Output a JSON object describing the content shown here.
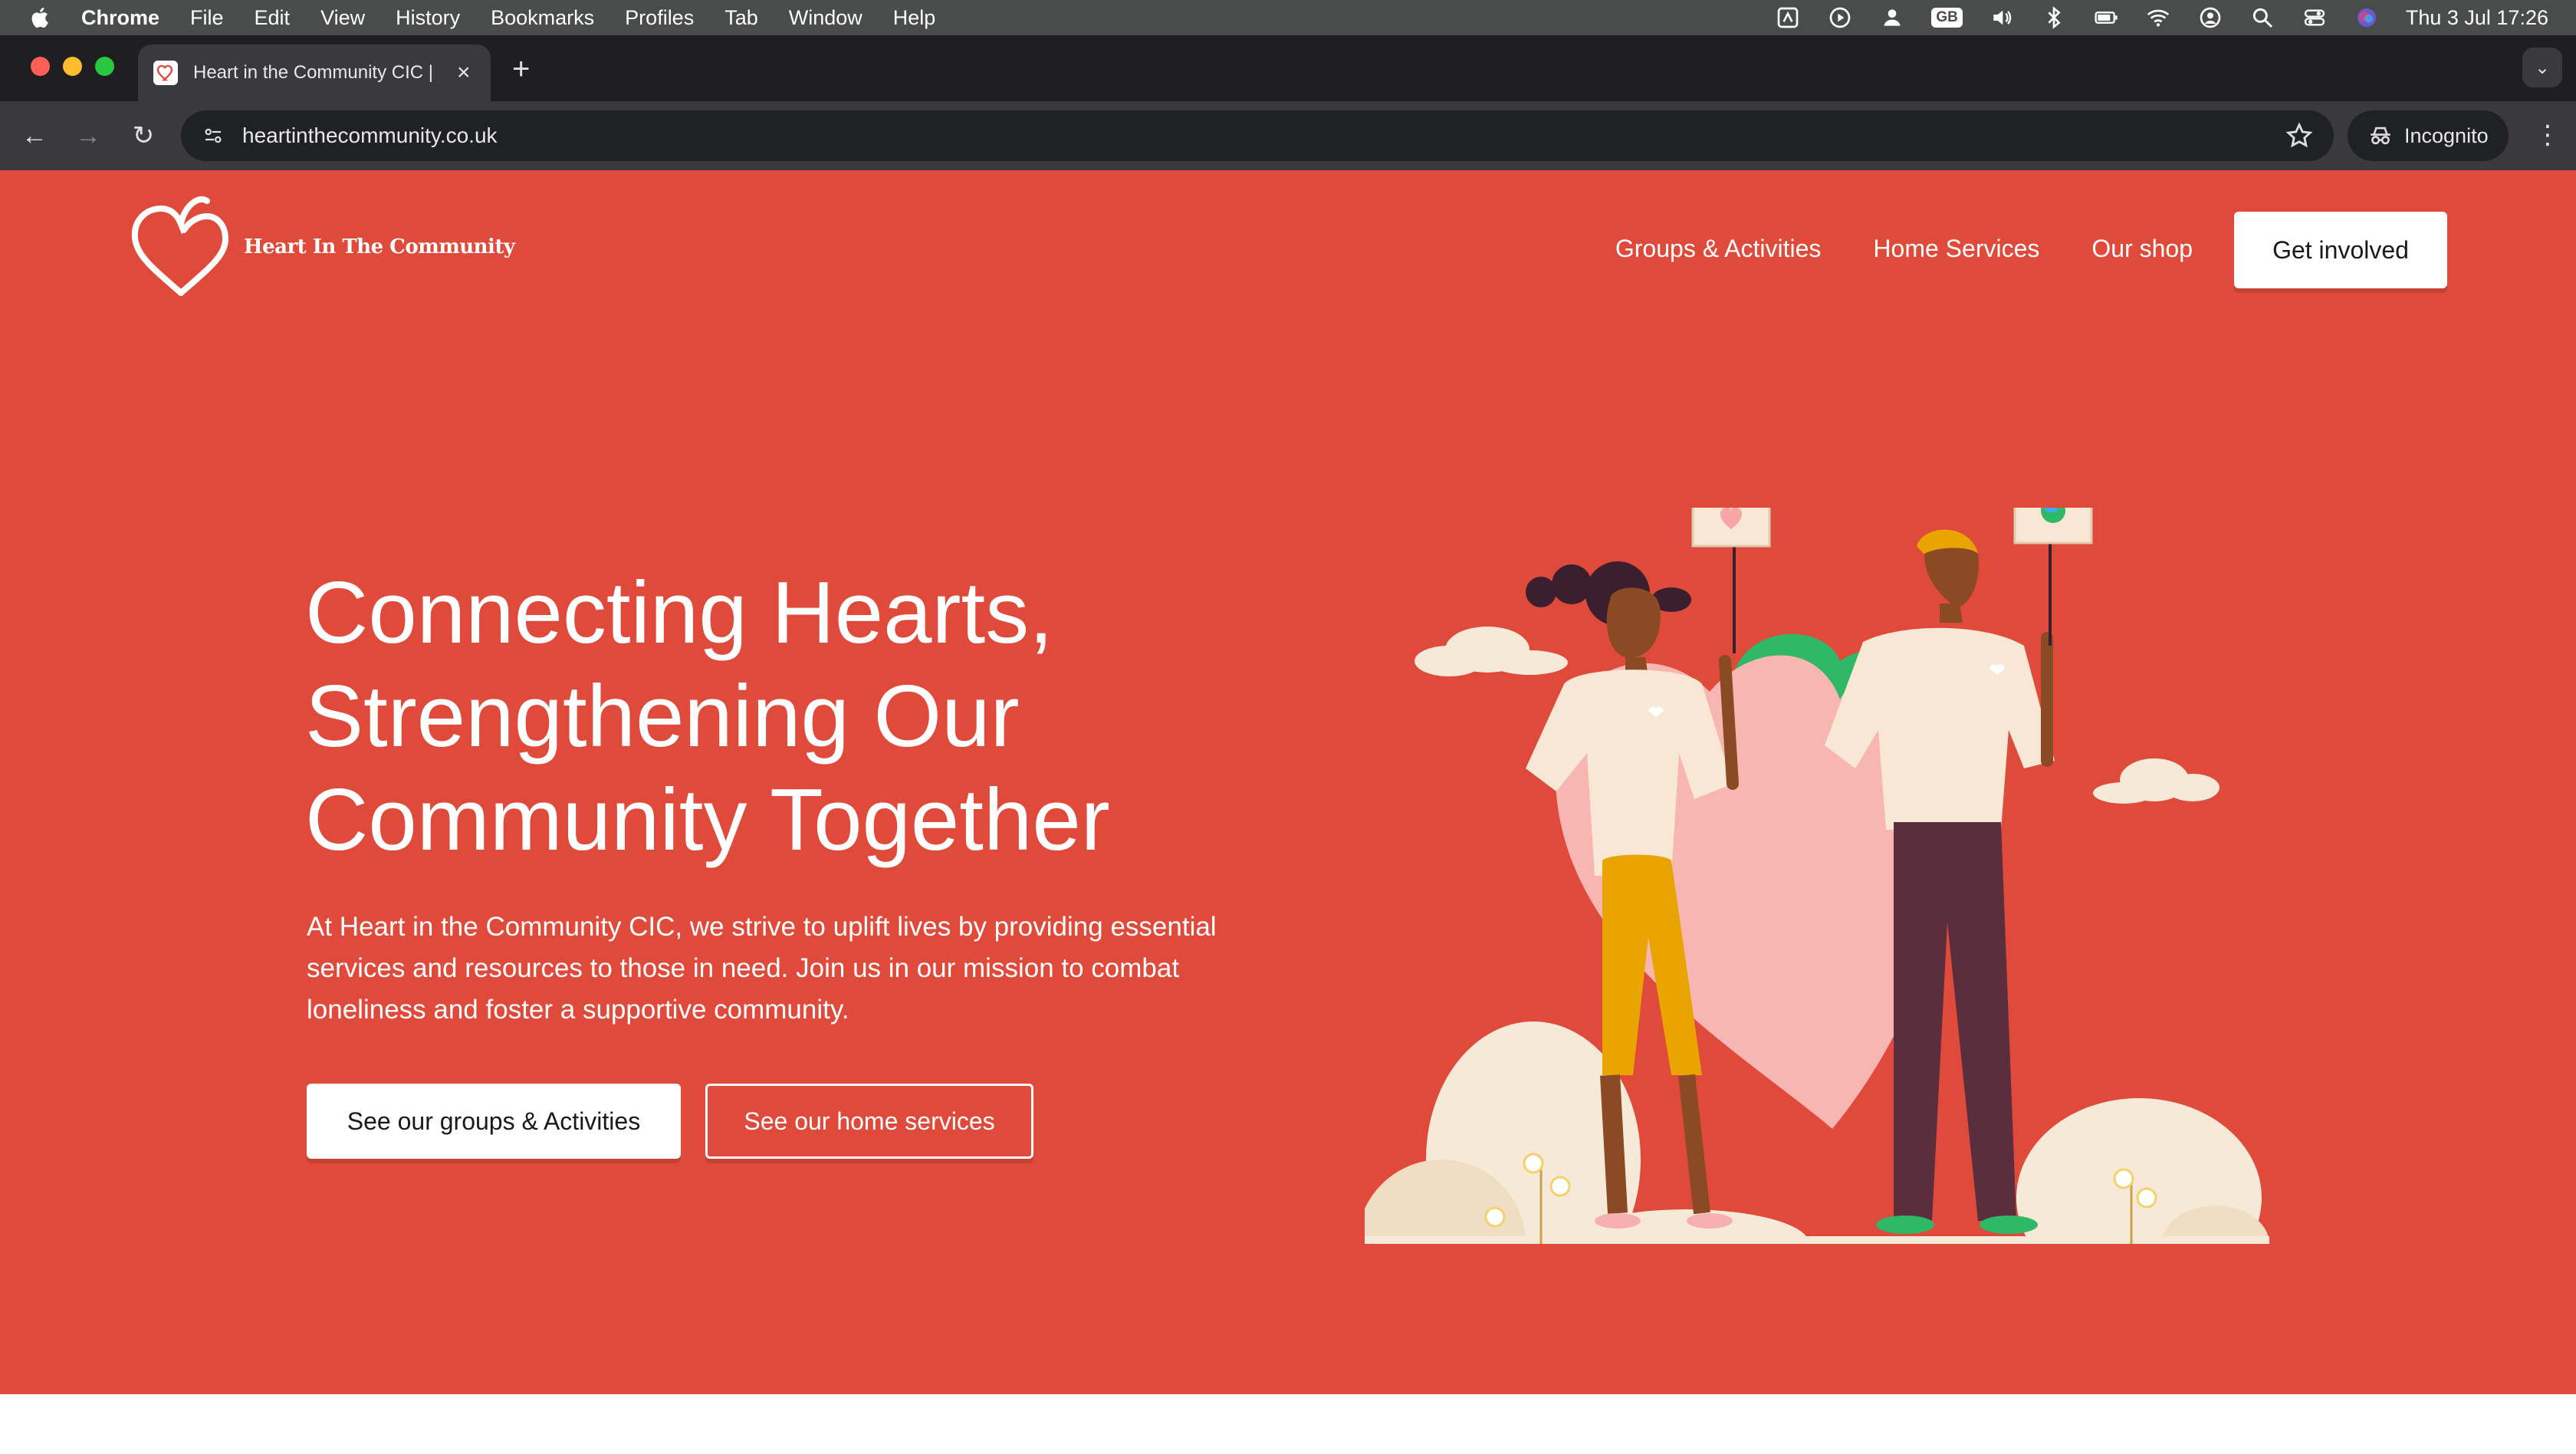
{
  "menubar": {
    "app_name": "Chrome",
    "items": [
      "File",
      "Edit",
      "View",
      "History",
      "Bookmarks",
      "Profiles",
      "Tab",
      "Window",
      "Help"
    ],
    "keyboard_layout": "GB",
    "clock": "Thu 3 Jul  17:26"
  },
  "browser": {
    "tab_title": "Heart in the Community CIC |",
    "url": "heartinthecommunity.co.uk",
    "incognito_label": "Incognito",
    "traffic_colors": [
      "#ff5f57",
      "#febc2e",
      "#28c840"
    ]
  },
  "site": {
    "brand": "Heart In The Community",
    "nav": [
      "Groups & Activities",
      "Home Services",
      "Our shop"
    ],
    "cta": "Get involved",
    "accent_color": "#e04a3b"
  },
  "hero": {
    "title_lines": [
      "Connecting Hearts,",
      "Strengthening Our",
      "Community Together"
    ],
    "text": "At Heart in the Community CIC, we strive to uplift lives by providing essential services and resources to those in need. Join us in our mission to combat loneliness and foster a supportive community.",
    "primary_button": "See our groups & Activities",
    "secondary_button": "See our home services"
  }
}
